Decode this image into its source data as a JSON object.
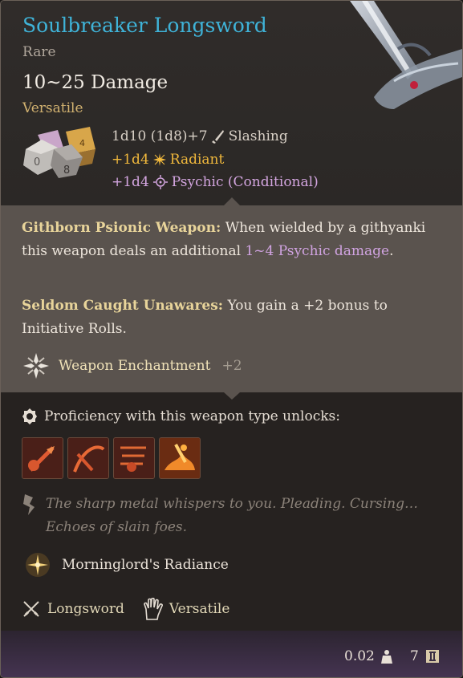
{
  "item": {
    "name": "Soulbreaker Longsword",
    "rarity": "Rare",
    "damage": "10~25 Damage",
    "property_tag": "Versatile"
  },
  "damage_rows": [
    {
      "text": "1d10 (1d8)+7",
      "icon": "slashing-icon",
      "type": "Slashing",
      "color": "#d8d0c6"
    },
    {
      "text": "+1d4",
      "icon": "radiant-icon",
      "type": "Radiant",
      "color": "#f0b83c"
    },
    {
      "text": "+1d4",
      "icon": "psychic-icon",
      "type": "Psychic (Conditional)",
      "color": "#d3a5df"
    }
  ],
  "abilities": [
    {
      "name": "Githborn Psionic Weapon:",
      "text_before": " When wielded by a githyanki this weapon deals an additional ",
      "highlight": "1~4 Psychic damage",
      "text_after": "."
    },
    {
      "name": "Seldom Caught Unawares:",
      "text": " You gain a +2 bonus to Initiative Rolls."
    }
  ],
  "enchantment": {
    "label": "Weapon Enchantment",
    "value": "+2",
    "icon": "enchantment-icon"
  },
  "proficiency": {
    "label": "Proficiency with this weapon type unlocks:",
    "icon": "proficiency-icon",
    "actions": [
      "pommel-strike-icon",
      "flourish-icon",
      "lacerate-icon",
      "rush-attack-icon"
    ]
  },
  "lore": "The sharp metal whispers to you. Pleading. Cursing… Echoes of slain foes.",
  "passive": {
    "label": "Morninglord's Radiance",
    "icon": "radiance-icon"
  },
  "properties": [
    {
      "label": "Longsword",
      "icon": "longsword-icon"
    },
    {
      "label": "Versatile",
      "icon": "versatile-hand-icon"
    }
  ],
  "footer": {
    "weight": "0.02",
    "weight_icon": "weight-icon",
    "value": "7",
    "value_icon": "gold-icon"
  },
  "colors": {
    "title": "#3fb3d8",
    "rarity": "#b1a79c",
    "versatile": "#d2b270",
    "radiant": "#f0b83c",
    "psychic": "#d3a5df",
    "ability_name": "#e8d49a"
  }
}
